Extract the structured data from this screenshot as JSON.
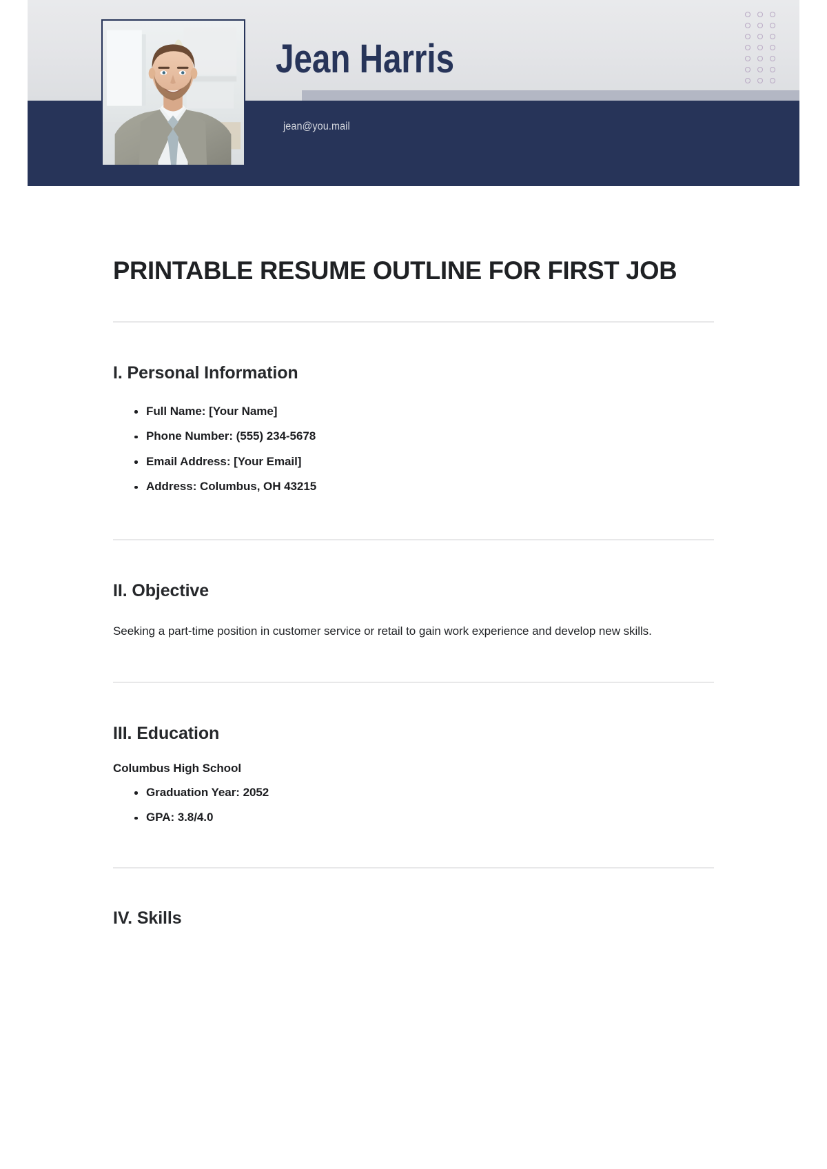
{
  "header": {
    "name": "Jean Harris",
    "email": "jean@you.mail",
    "photo_alt": "portrait-photo",
    "colors": {
      "navy": "#273459",
      "band_gray": "#e3e4e7",
      "accent_bar": "#b3b7c4",
      "dot": "#b9a9c4",
      "email_text": "#d4d7de"
    },
    "dot_grid": {
      "columns": 3,
      "rows": 7
    }
  },
  "document": {
    "title": "PRINTABLE RESUME OUTLINE FOR FIRST JOB",
    "sections": [
      {
        "heading": "I. Personal Information",
        "bullets": [
          {
            "label": "Full Name",
            "value": "[Your Name]"
          },
          {
            "label": "Phone Number",
            "value": "(555) 234-5678"
          },
          {
            "label": "Email Address",
            "value": "[Your Email]"
          },
          {
            "label": "Address",
            "value": "Columbus, OH 43215"
          }
        ]
      },
      {
        "heading": "II. Objective",
        "paragraph": "Seeking a part-time position in customer service or retail to gain work experience and develop new skills."
      },
      {
        "heading": "III. Education",
        "subheading": "Columbus High School",
        "bullets": [
          {
            "label": "Graduation Year",
            "value": "2052"
          },
          {
            "label": "GPA",
            "value": "3.8/4.0"
          }
        ]
      },
      {
        "heading": "IV. Skills"
      }
    ]
  }
}
